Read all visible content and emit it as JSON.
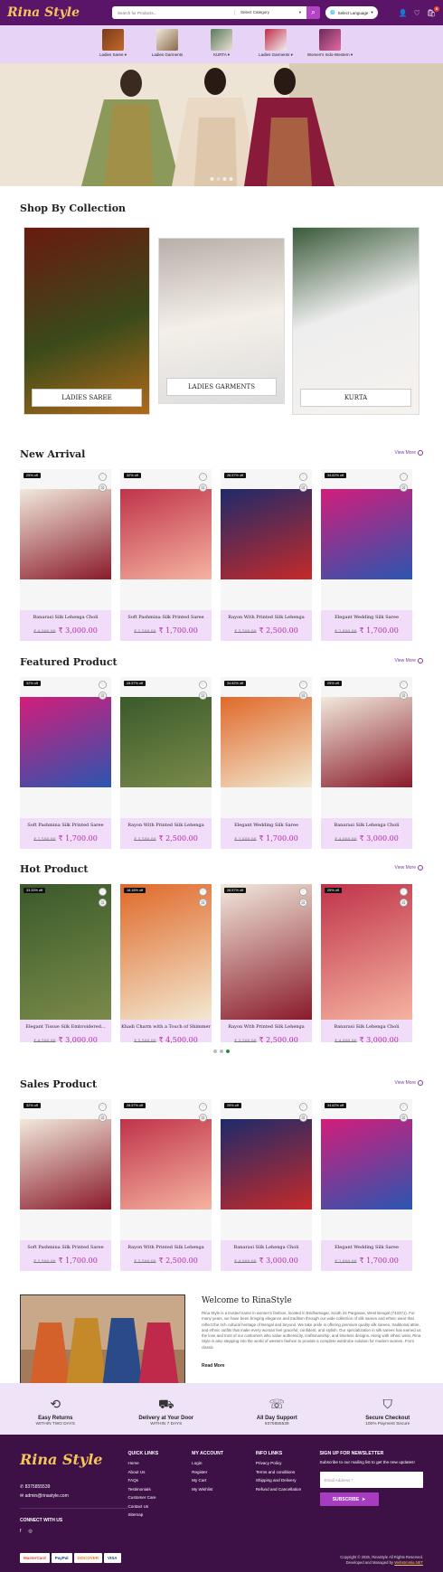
{
  "header": {
    "logo": "Rina Style",
    "search_placeholder": "Search for Products...",
    "category": "Select Category",
    "language": "Select Language",
    "cart_count": "0"
  },
  "categories": [
    {
      "label": "Ladies Saree ▾"
    },
    {
      "label": "Ladies Garments"
    },
    {
      "label": "KURTA ▾"
    },
    {
      "label": "Ladies Garments ▾"
    },
    {
      "label": "Women's Indo-Western ▾"
    }
  ],
  "collection": {
    "title": "Shop By Collection",
    "items": [
      "LADIES SAREE",
      "LADIES GARMENTS",
      "KURTA"
    ]
  },
  "view_more": "View More",
  "new_arrival": {
    "title": "New Arrival",
    "products": [
      {
        "disc": "25% off",
        "name": "Banarasi Silk Lehenga Choli",
        "old": "₹ 4,000.00",
        "price": "₹ 3,000.00"
      },
      {
        "disc": "32% off",
        "name": "Soft Pashmina Silk Printed Saree",
        "old": "₹ 2,500.00",
        "price": "₹ 1,700.00"
      },
      {
        "disc": "28.57% off",
        "name": "Rayon With Printed Silk Lehenga",
        "old": "₹ 3,500.00",
        "price": "₹ 2,500.00"
      },
      {
        "disc": "34.62% off",
        "name": "Elegant Wedding Silk Saree",
        "old": "₹ 2,600.00",
        "price": "₹ 1,700.00"
      }
    ]
  },
  "featured": {
    "title": "Featured Product",
    "products": [
      {
        "disc": "32% off",
        "name": "Soft Pashmina Silk Printed Saree",
        "old": "₹ 2,500.00",
        "price": "₹ 1,700.00"
      },
      {
        "disc": "28.57% off",
        "name": "Rayon With Printed Silk Lehenga",
        "old": "₹ 3,500.00",
        "price": "₹ 2,500.00"
      },
      {
        "disc": "34.62% off",
        "name": "Elegant Wedding Silk Saree",
        "old": "₹ 2,600.00",
        "price": "₹ 1,700.00"
      },
      {
        "disc": "25% off",
        "name": "Banarasi Silk Lehenga Choli",
        "old": "₹ 4,000.00",
        "price": "₹ 3,000.00"
      }
    ]
  },
  "hot": {
    "title": "Hot Product",
    "products": [
      {
        "disc": "33.33% off",
        "name": "Elegant Tissue Silk Embroidered...",
        "old": "₹ 4,500.00",
        "price": "₹ 3,000.00"
      },
      {
        "disc": "18.18% off",
        "name": "Khadi Charm with a Touch of Shimmer",
        "old": "₹ 5,500.00",
        "price": "₹ 4,500.00"
      },
      {
        "disc": "28.57% off",
        "name": "Rayon With Printed Silk Lehenga",
        "old": "₹ 3,500.00",
        "price": "₹ 2,500.00"
      },
      {
        "disc": "25% off",
        "name": "Banarasi Silk Lehenga Choli",
        "old": "₹ 4,000.00",
        "price": "₹ 3,000.00"
      }
    ]
  },
  "sales": {
    "title": "Sales Product",
    "products": [
      {
        "disc": "32% off",
        "name": "Soft Pashmina Silk Printed Saree",
        "old": "₹ 2,500.00",
        "price": "₹ 1,700.00"
      },
      {
        "disc": "28.57% off",
        "name": "Rayon With Printed Silk Lehenga",
        "old": "₹ 3,500.00",
        "price": "₹ 2,500.00"
      },
      {
        "disc": "25% off",
        "name": "Banarasi Silk Lehenga Choli",
        "old": "₹ 4,000.00",
        "price": "₹ 3,000.00"
      },
      {
        "disc": "34.62% off",
        "name": "Elegant Wedding Silk Saree",
        "old": "₹ 2,600.00",
        "price": "₹ 1,700.00"
      }
    ]
  },
  "welcome": {
    "title": "Welcome to RinaStyle",
    "text": "Rina Style is a trusted name in women's fashion, located in Bridhamagar, South 24 Parganas, West Bengal (743371). For many years, we have been bringing elegance and tradition through our wide collection of silk sarees and ethnic wear that reflect the rich cultural heritage of Bengal and beyond. We take pride in offering premium quality silk sarees, traditional attire, and ethnic outfits that make every woman feel graceful, confident, and stylish. Our specialization in silk sarees has earned us the love and trust of our customers who value authenticity, craftsmanship, and timeless designs. Along with ethnic wear, Rina Style is also stepping into the world of western fashion to provide a complete wardrobe solution for modern women. From classic",
    "read_more": "Read More"
  },
  "features": [
    {
      "title": "Easy Returns",
      "sub": "WITHIN TWO DAYS"
    },
    {
      "title": "Delivery at Your Door",
      "sub": "WITHIN 7 DAYS"
    },
    {
      "title": "All Day Support",
      "sub": "8375855539"
    },
    {
      "title": "Secure Checkout",
      "sub": "100% Payment Secure"
    }
  ],
  "footer": {
    "logo": "Rina Style",
    "phone": "8375855539",
    "email": "admin@rinastyle.com",
    "connect": "CONNECT WITH US",
    "quick": {
      "title": "QUICK LINKS",
      "items": [
        "Home",
        "About Us",
        "FAQs",
        "Testimonials",
        "Customer Care",
        "Contact Us",
        "Sitemap"
      ]
    },
    "account": {
      "title": "MY ACCOUNT",
      "items": [
        "Login",
        "Register",
        "My Cart",
        "My Wishlist"
      ]
    },
    "info": {
      "title": "INFO LINKS",
      "items": [
        "Privacy Policy",
        "Terms and conditions",
        "Shipping and Delivery",
        "Refund and Cancellation"
      ]
    },
    "news": {
      "title": "SIGN UP FOR NEWSLETTER",
      "text": "Subscribe to our mailing list to get the new updates!",
      "placeholder": "Email Address *",
      "button": "SUBSCRIBE"
    },
    "payments": [
      "MasterCard",
      "PayPal",
      "DISCOVER",
      "VISA"
    ],
    "copy1": "Copyright © 2025, RinaStyle All Rights Reserved.",
    "copy2": "Developed and Managed by",
    "dev": "Webstrontia.NET"
  }
}
